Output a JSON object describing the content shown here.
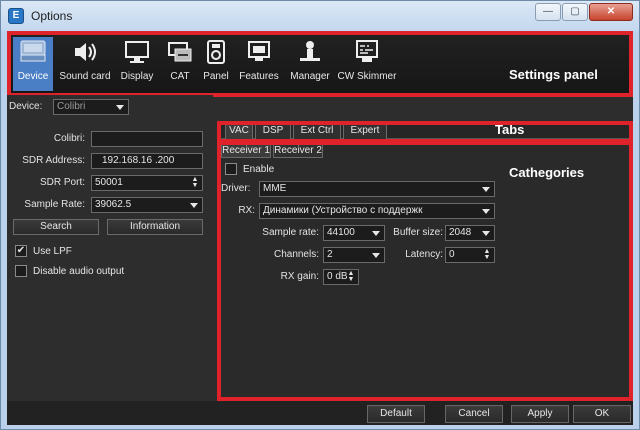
{
  "window": {
    "title": "Options",
    "min_icon": "minimize-icon",
    "max_icon": "maximize-icon",
    "close_icon": "close-icon"
  },
  "toolbar": {
    "items": [
      {
        "label": "Device",
        "icon": "device-icon",
        "active": true
      },
      {
        "label": "Sound card",
        "icon": "speaker-icon"
      },
      {
        "label": "Display",
        "icon": "monitor-icon"
      },
      {
        "label": "CAT",
        "icon": "cat-icon"
      },
      {
        "label": "Panel",
        "icon": "panel-icon"
      },
      {
        "label": "Features",
        "icon": "features-icon"
      },
      {
        "label": "Manager",
        "icon": "manager-icon"
      },
      {
        "label": "CW Skimmer",
        "icon": "cw-skimmer-icon"
      }
    ]
  },
  "annotations": {
    "settings_panel": "Settings panel",
    "tabs": "Tabs",
    "categories": "Cathegories",
    "accent": "#e0222a"
  },
  "left": {
    "device_label": "Device:",
    "device_value": "Colibri",
    "colibri_label": "Colibri:",
    "colibri_value": "",
    "sdr_address_label": "SDR Address:",
    "sdr_address_value": "192.168.16 .200",
    "sdr_port_label": "SDR Port:",
    "sdr_port_value": "50001",
    "sample_rate_label": "Sample Rate:",
    "sample_rate_value": "39062.5",
    "search_button": "Search",
    "info_button": "Information",
    "use_lpf_label": "Use LPF",
    "use_lpf_checked": true,
    "disable_audio_label": "Disable audio output",
    "disable_audio_checked": false
  },
  "right": {
    "tabs": [
      "VAC",
      "DSP",
      "Ext Ctrl",
      "Expert"
    ],
    "subtabs": [
      "Receiver 1",
      "Receiver 2"
    ],
    "enable_label": "Enable",
    "driver_label": "Driver:",
    "driver_value": "MME",
    "rx_label": "RX:",
    "rx_value": "Динамики (Устройство с поддержк",
    "sample_rate_label": "Sample rate:",
    "sample_rate_value": "44100",
    "buffer_size_label": "Buffer size:",
    "buffer_size_value": "2048",
    "channels_label": "Channels:",
    "channels_value": "2",
    "latency_label": "Latency:",
    "latency_value": "0",
    "rx_gain_label": "RX gain:",
    "rx_gain_value": "0 dB"
  },
  "footer": {
    "default": "Default",
    "cancel": "Cancel",
    "apply": "Apply",
    "ok": "OK"
  }
}
